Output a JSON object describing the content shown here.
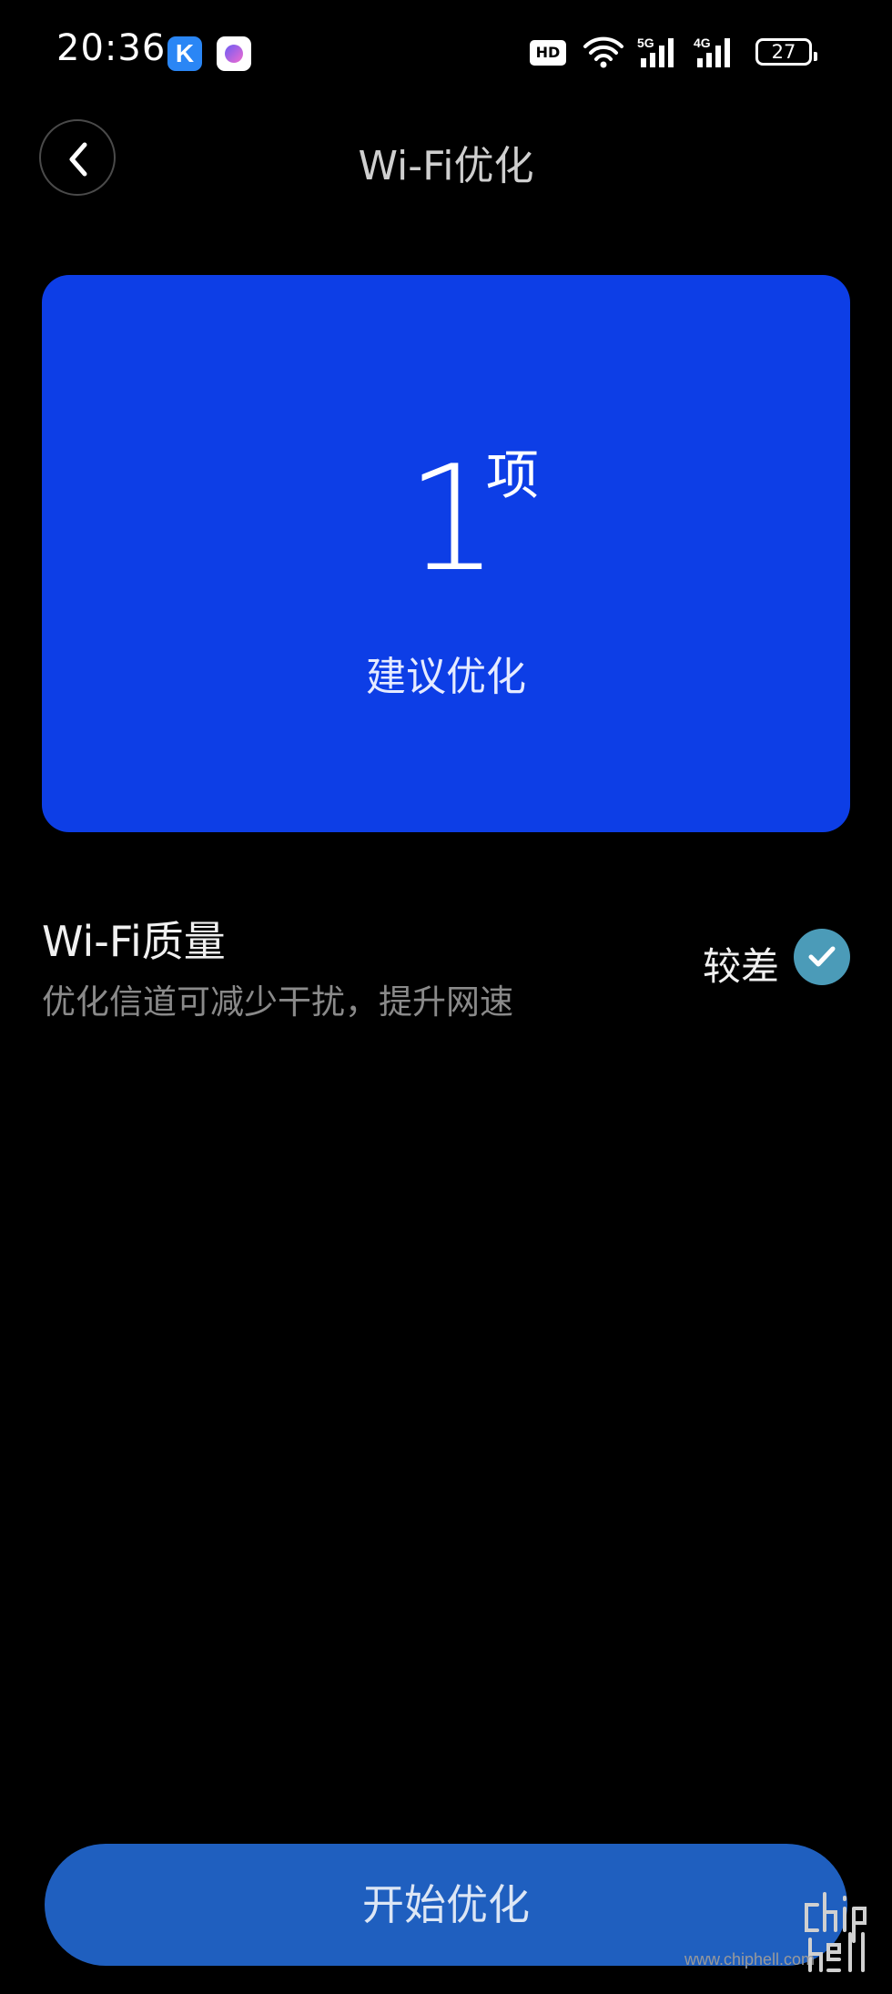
{
  "status_bar": {
    "time": "20:36",
    "app_icons": [
      "k-app-icon",
      "bubble-app-icon"
    ],
    "hd_label": "HD",
    "network_5g": "5G",
    "network_4g": "4G",
    "battery": "27"
  },
  "header": {
    "title": "Wi-Fi优化",
    "back_icon": "chevron-left-icon"
  },
  "summary": {
    "count": "1",
    "unit": "项",
    "caption": "建议优化",
    "color": "#0d3ee6"
  },
  "items": [
    {
      "title": "Wi-Fi质量",
      "description": "优化信道可减少干扰，提升网速",
      "status": "较差",
      "checked": true,
      "check_color": "#4b9bb8"
    }
  ],
  "action": {
    "label": "开始优化",
    "color": "#1f5fbf"
  },
  "watermark": {
    "logo_text": "chiphell",
    "url": "www.chiphell.com"
  }
}
